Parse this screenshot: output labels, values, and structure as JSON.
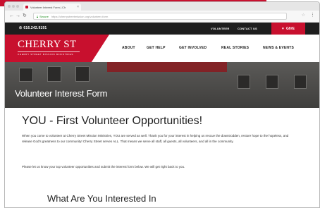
{
  "browser": {
    "tab_title": "Volunteer Interest Form | Ch",
    "url_prefix": "Secure",
    "url": "https://cherrystreetmission.org/volunteer-form"
  },
  "topbar": {
    "phone": "616.242.9191",
    "links": [
      "VOLUNTEER",
      "CONTACT US"
    ],
    "give": "GIVE"
  },
  "logo": {
    "name": "CHERRY ST",
    "tagline": "CHERRY STREET MISSION MINISTRIES"
  },
  "nav": {
    "items": [
      "ABOUT",
      "GET HELP",
      "GET INVOLVED",
      "REAL STORIES",
      "NEWS & EVENTS"
    ]
  },
  "hero": {
    "title": "Volunteer Interest Form"
  },
  "content": {
    "heading": "YOU - First Volunteer Opportunities!",
    "paragraph1": "When you come to volunteer at Cherry Street Mission Ministries, YOU are served as well. Thank you for your interest in helping us rescue the downtrodden, restore hope to the hopeless, and release God's greatness to our community! Cherry Street serves ALL. That means we serve all staff, all guests, all volunteers, and all in the community.",
    "paragraph2": "Please let us know your top volunteer opportunities and submit the interest form below. We will get right back to you.",
    "subheading": "What Are You Interested In"
  },
  "colors": {
    "brand_red": "#c8102e",
    "topbar": "#1e1e1e"
  }
}
